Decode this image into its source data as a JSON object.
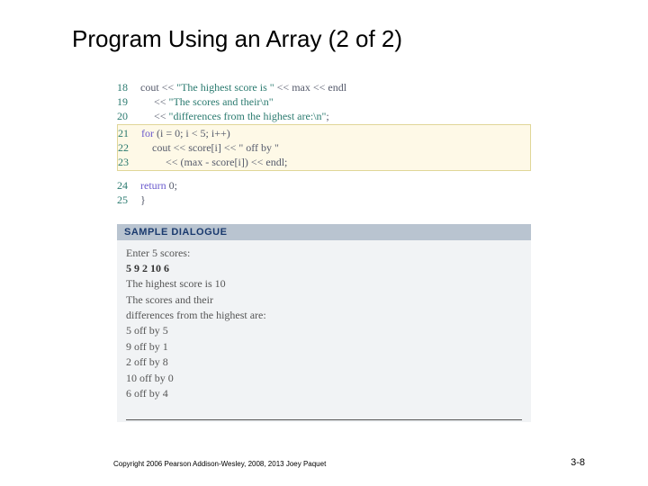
{
  "title": "Program Using an Array (2 of 2)",
  "code": {
    "top": [
      {
        "n": "18",
        "pre": "cout << ",
        "str": "\"The highest score is \"",
        "post": " << max << endl"
      },
      {
        "n": "19",
        "pre": "     << ",
        "str": "\"The scores and their\\n\"",
        "post": ""
      },
      {
        "n": "20",
        "pre": "     << ",
        "str": "\"differences from the highest are:\\n\"",
        "post": ";"
      }
    ],
    "hl": [
      {
        "n": "21",
        "kw": "for",
        "rest": " (i = 0; i < 5; i++)"
      },
      {
        "n": "22",
        "kw": "",
        "rest": "    cout << score[i] << \" off by \""
      },
      {
        "n": "23",
        "kw": "",
        "rest": "         << (max - score[i]) << endl;"
      }
    ],
    "bottom": [
      {
        "n": "24",
        "pre": "",
        "kw": "return",
        "rest": " 0;"
      },
      {
        "n": "25",
        "pre": "}",
        "kw": "",
        "rest": ""
      }
    ]
  },
  "dialogue": {
    "header": "SAMPLE DIALOGUE",
    "lines": [
      {
        "t": "Enter 5 scores:",
        "b": false
      },
      {
        "t": "5 9 2 10 6",
        "b": true
      },
      {
        "t": "The highest score is 10",
        "b": false
      },
      {
        "t": "The scores and their",
        "b": false
      },
      {
        "t": "differences from the highest are:",
        "b": false
      },
      {
        "t": "5 off by 5",
        "b": false
      },
      {
        "t": "9 off by 1",
        "b": false
      },
      {
        "t": "2 off by 8",
        "b": false
      },
      {
        "t": "10 off by 0",
        "b": false
      },
      {
        "t": "6 off by 4",
        "b": false
      }
    ]
  },
  "footer": {
    "left": "Copyright 2006 Pearson Addison-Wesley, 2008, 2013 Joey Paquet",
    "right": "3-8"
  }
}
